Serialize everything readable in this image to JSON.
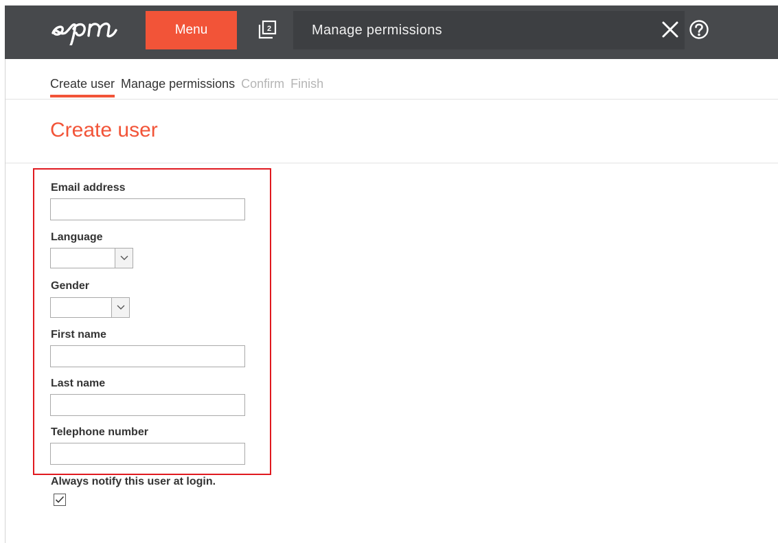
{
  "header": {
    "menu_label": "Menu",
    "tabs_count": "2",
    "title": "Manage permissions",
    "brand_color": "#f25438",
    "bar_color": "#47494c"
  },
  "steps": [
    {
      "label": "Create user",
      "state": "active"
    },
    {
      "label": "Manage permissions",
      "state": "enabled"
    },
    {
      "label": "Confirm",
      "state": "disabled"
    },
    {
      "label": "Finish",
      "state": "disabled"
    }
  ],
  "page_title": "Create user",
  "form": {
    "email": {
      "label": "Email address",
      "value": ""
    },
    "language": {
      "label": "Language",
      "selected": ""
    },
    "gender": {
      "label": "Gender",
      "selected": ""
    },
    "first_name": {
      "label": "First name",
      "value": ""
    },
    "last_name": {
      "label": "Last name",
      "value": ""
    },
    "telephone": {
      "label": "Telephone number",
      "value": ""
    },
    "notify": {
      "label": "Always notify this user at login.",
      "checked": true
    }
  },
  "highlight_color": "#e0191f"
}
